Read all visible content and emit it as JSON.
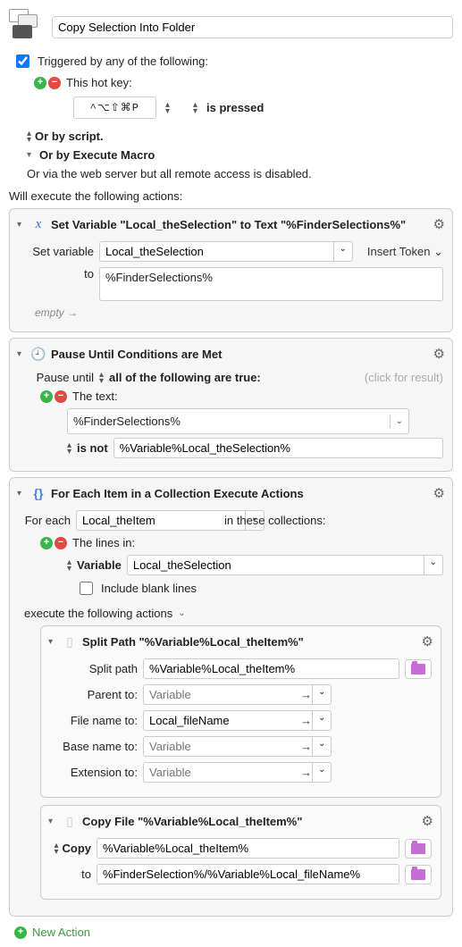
{
  "macro_title": "Copy Selection Into Folder",
  "triggers": {
    "checkbox_label": "Triggered by any of the following:",
    "hotkey_label": "This hot key:",
    "hotkey": "^⌥⇧⌘P",
    "hotkey_mode": "is pressed",
    "or_script": "Or by script.",
    "or_execute_macro": "Or by Execute Macro",
    "or_web": "Or via the web server but all remote access is disabled."
  },
  "will_execute": "Will execute the following actions:",
  "actions": {
    "set_var": {
      "title": "Set Variable \"Local_theSelection\" to Text \"%FinderSelections%\"",
      "label_set_variable": "Set variable",
      "var_name": "Local_theSelection",
      "insert_token": "Insert Token",
      "label_to": "to",
      "value": "%FinderSelections%",
      "empty": "empty →"
    },
    "pause": {
      "title": "Pause Until Conditions are Met",
      "pause_until": "Pause until",
      "all_true": "all of the following are true:",
      "click_result": "(click for result)",
      "text_label": "The text:",
      "text_value": "%FinderSelections%",
      "is_not": "is not",
      "compare_value": "%Variable%Local_theSelection%"
    },
    "foreach": {
      "title": "For Each Item in a Collection Execute Actions",
      "for_each": "For each",
      "var_name": "Local_theItem",
      "in_collections": "in these collections:",
      "lines_in": "The lines in:",
      "variable_label": "Variable",
      "variable_value": "Local_theSelection",
      "include_blank": "Include blank lines",
      "execute_label": "execute the following actions",
      "split": {
        "title": "Split Path \"%Variable%Local_theItem%\"",
        "split_path_label": "Split path",
        "split_path_value": "%Variable%Local_theItem%",
        "parent_to": "Parent to:",
        "filename_to": "File name to:",
        "filename_value": "Local_fileName",
        "basename_to": "Base name to:",
        "extension_to": "Extension to:",
        "placeholder": "Variable"
      },
      "copy": {
        "title": "Copy File \"%Variable%Local_theItem%\"",
        "copy_label": "Copy",
        "src_value": "%Variable%Local_theItem%",
        "to_label": "to",
        "dst_value": "%FinderSelection%/%Variable%Local_fileName%"
      }
    }
  },
  "new_action": "New Action"
}
